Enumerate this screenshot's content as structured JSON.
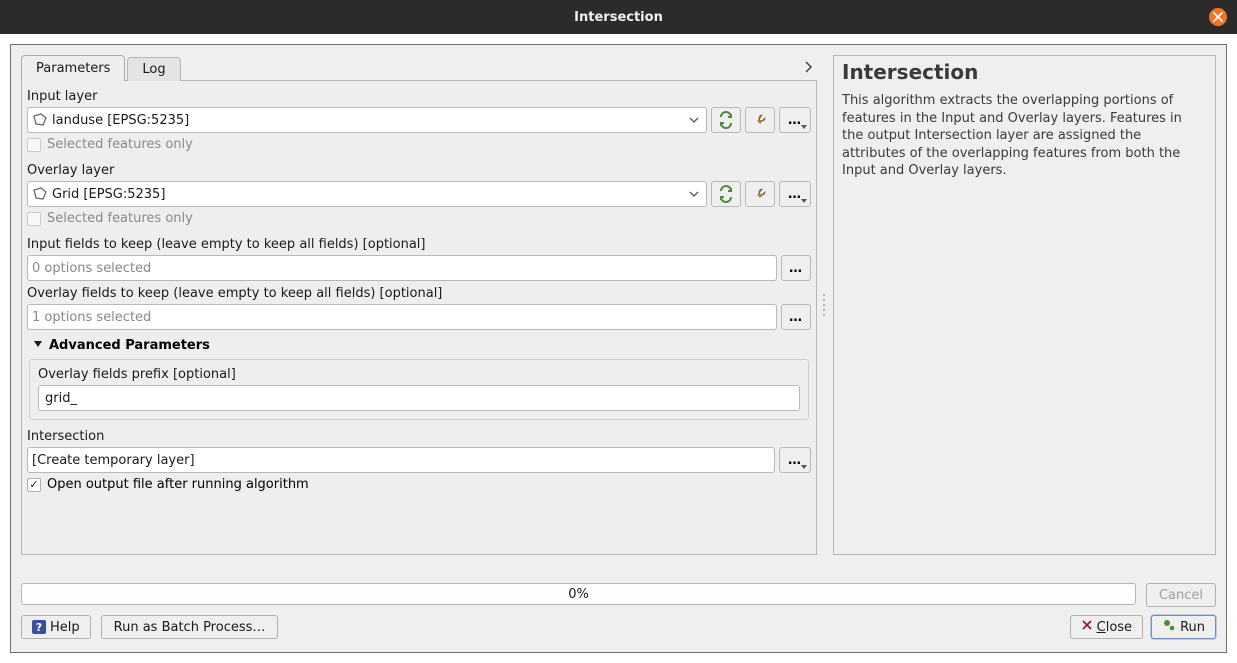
{
  "window": {
    "title": "Intersection"
  },
  "tabs": {
    "parameters": "Parameters",
    "log": "Log"
  },
  "input_layer": {
    "label": "Input layer",
    "value": "landuse [EPSG:5235]",
    "selected_only_label": "Selected features only",
    "selected_only_checked": false
  },
  "overlay_layer": {
    "label": "Overlay layer",
    "value": "Grid [EPSG:5235]",
    "selected_only_label": "Selected features only",
    "selected_only_checked": false
  },
  "input_fields": {
    "label": "Input fields to keep (leave empty to keep all fields) [optional]",
    "value": "0 options selected"
  },
  "overlay_fields": {
    "label": "Overlay fields to keep (leave empty to keep all fields) [optional]",
    "value": "1 options selected"
  },
  "advanced": {
    "header": "Advanced Parameters",
    "prefix_label": "Overlay fields prefix [optional]",
    "prefix_value": "grid_"
  },
  "output": {
    "label": "Intersection",
    "placeholder": "[Create temporary layer]",
    "open_after_label": "Open output file after running algorithm",
    "open_after_checked": true
  },
  "help": {
    "title": "Intersection",
    "body": "This algorithm extracts the overlapping portions of features in the Input and Overlay layers. Features in the output Intersection layer are assigned the attributes of the overlapping features from both the Input and Overlay layers."
  },
  "progress": {
    "text": "0%"
  },
  "buttons": {
    "help": "Help",
    "batch": "Run as Batch Process…",
    "cancel": "Cancel",
    "close": "Close",
    "run": "Run"
  }
}
